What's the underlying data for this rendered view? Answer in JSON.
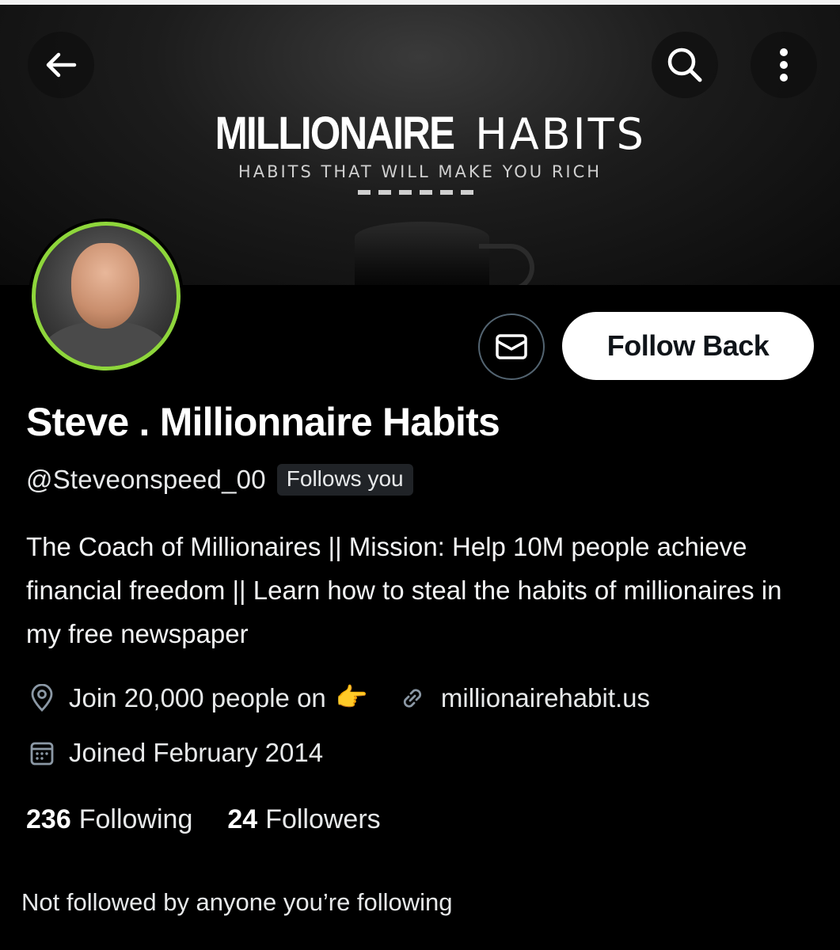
{
  "banner": {
    "title_bold": "MILLIONAIRE",
    "title_light": "HABITS",
    "tagline": "HABITS THAT WILL MAKE YOU RICH"
  },
  "header": {
    "back_icon": "arrow-left-icon",
    "search_icon": "search-icon",
    "more_icon": "more-vertical-icon"
  },
  "profile": {
    "display_name": "Steve . Millionnaire Habits",
    "handle": "@Steveonspeed_00",
    "follows_you_badge": "Follows you",
    "bio": "The Coach of Millionaires || Mission: Help 10M people achieve financial freedom || Learn how to steal the habits of millionaires in my free newspaper",
    "location": "Join 20,000 people on",
    "location_emoji": "👉",
    "website": "millionairehabit.us",
    "joined": "Joined February 2014",
    "following_count": "236",
    "following_label": "Following",
    "followers_count": "24",
    "followers_label": "Followers",
    "mutuals_text": "Not followed by anyone you’re following"
  },
  "actions": {
    "follow_back_label": "Follow Back",
    "message_icon": "mail-icon"
  },
  "colors": {
    "background": "#000000",
    "avatar_ring": "#8ed63b",
    "follow_button_bg": "#ffffff",
    "badge_bg": "#202327"
  }
}
